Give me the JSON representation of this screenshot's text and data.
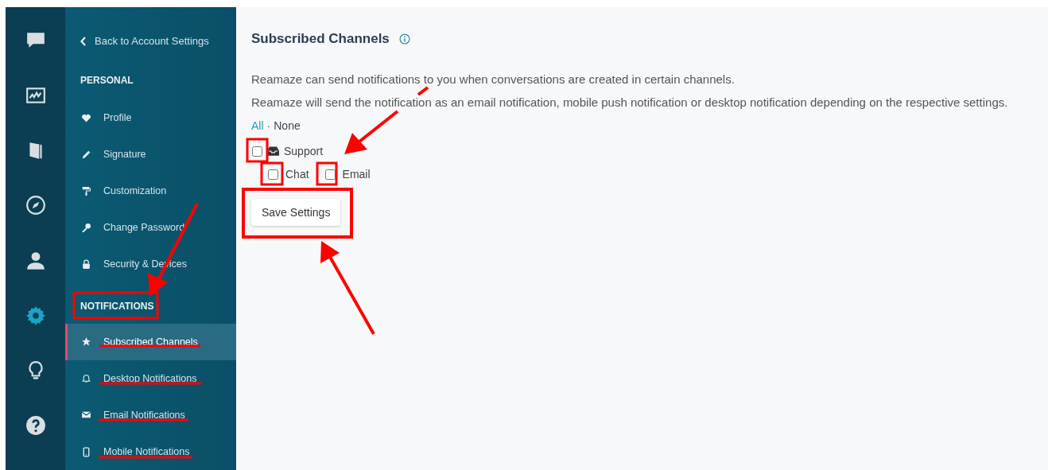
{
  "rail_items": [
    {
      "selected": false
    },
    {
      "selected": false
    },
    {
      "selected": false
    },
    {
      "selected": false
    },
    {
      "selected": false
    },
    {
      "selected": true
    },
    {
      "selected": false
    },
    {
      "selected": false
    }
  ],
  "sidebar": {
    "back_link": "Back to Account Settings",
    "sections": [
      {
        "heading": "PERSONAL",
        "items": [
          {
            "label": "Profile",
            "selected": false
          },
          {
            "label": "Signature",
            "selected": false
          },
          {
            "label": "Customization",
            "selected": false
          },
          {
            "label": "Change Password",
            "selected": false
          },
          {
            "label": "Security & Devices",
            "selected": false
          }
        ]
      },
      {
        "heading": "NOTIFICATIONS",
        "items": [
          {
            "label": "Subscribed Channels",
            "selected": true
          },
          {
            "label": "Desktop Notifications",
            "selected": false
          },
          {
            "label": "Email Notifications",
            "selected": false
          },
          {
            "label": "Mobile Notifications",
            "selected": false
          }
        ]
      }
    ]
  },
  "content": {
    "title": "Subscribed Channels",
    "description": [
      "Reamaze can send notifications to you when conversations are created in certain channels.",
      "Reamaze will send the notification as an email notification, mobile push notification or desktop notification depending on the respective settings."
    ],
    "select_all": "All",
    "separator": "·",
    "select_none": "None",
    "channel_group": {
      "label": "Support",
      "checked": false,
      "children": [
        {
          "label": "Chat",
          "checked": false
        },
        {
          "label": "Email",
          "checked": false
        }
      ]
    },
    "save_button": "Save Settings"
  }
}
